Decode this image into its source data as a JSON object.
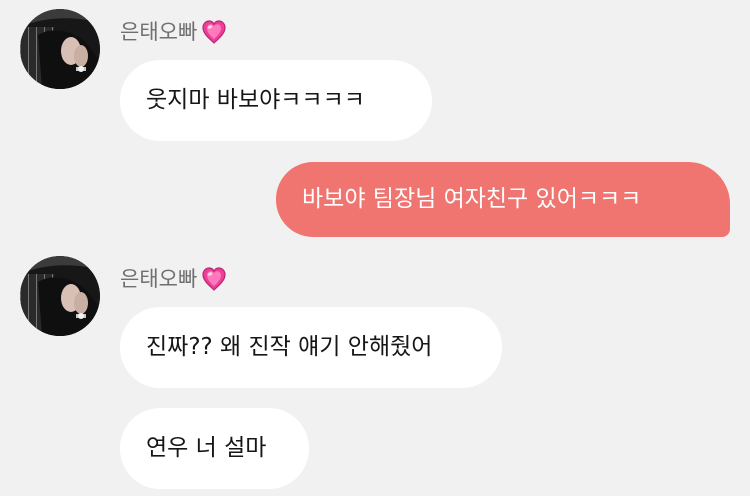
{
  "app": {
    "background_color": "#f1f1f1",
    "outgoing_bubble_color": "#f07570",
    "incoming_bubble_color": "#ffffff"
  },
  "messages": [
    {
      "sender": "은태오빠",
      "avatar_icon": "profile-photo-holding-hands",
      "heart_icon": "pink-heart-icon",
      "text": "웃지마 바보야ㅋㅋㅋㅋ"
    },
    {
      "sender": "me",
      "text": "바보야 팀장님 여자친구 있어ㅋㅋㅋ"
    },
    {
      "sender": "은태오빠",
      "avatar_icon": "profile-photo-holding-hands",
      "heart_icon": "pink-heart-icon",
      "text": "진짜?? 왜 진작 얘기 안해줬어"
    },
    {
      "sender": "은태오빠",
      "text": "연우 너 설마"
    }
  ]
}
